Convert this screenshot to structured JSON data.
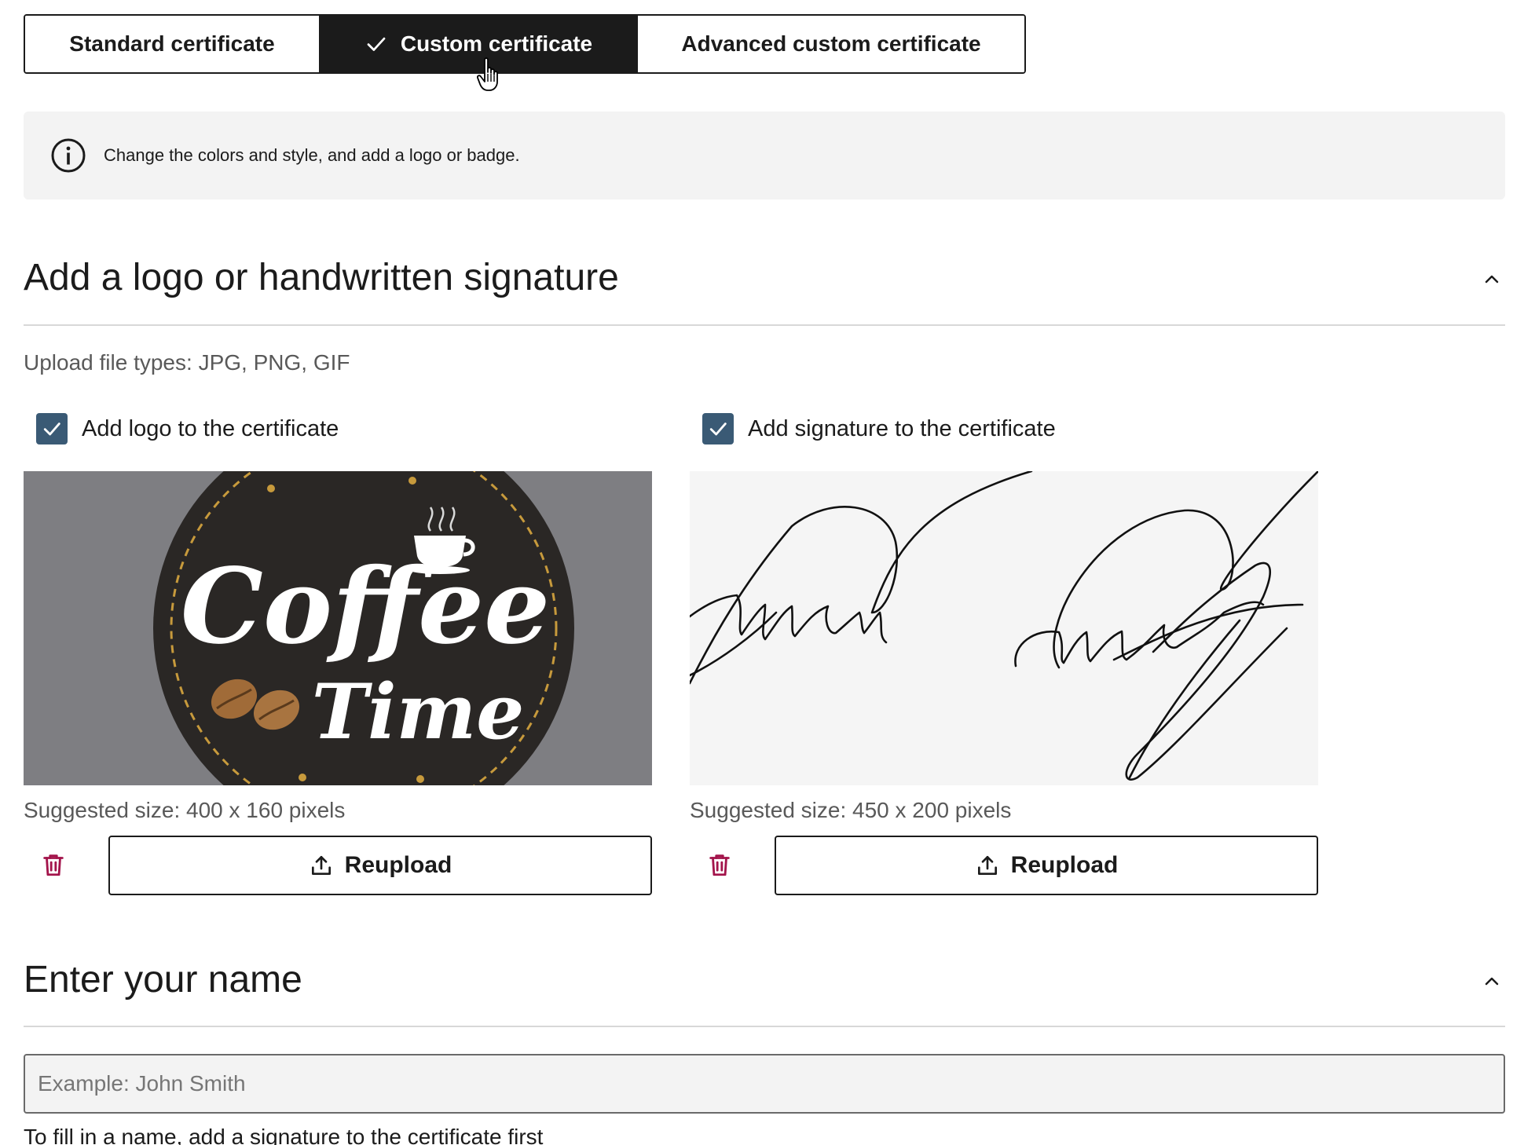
{
  "tabs": [
    {
      "label": "Standard certificate",
      "selected": false
    },
    {
      "label": "Custom certificate",
      "selected": true
    },
    {
      "label": "Advanced custom certificate",
      "selected": false
    }
  ],
  "info": {
    "icon": "info-circle-icon",
    "text": "Change the colors and style, and add a logo or badge."
  },
  "logo_section": {
    "title": "Add a logo or handwritten signature",
    "expanded": true,
    "file_types_hint": "Upload file types: JPG, PNG, GIF",
    "logo": {
      "checkbox_label": "Add logo to the certificate",
      "checked": true,
      "image": {
        "line1": "Coffee",
        "line2": "Time"
      },
      "size_note": "Suggested size: 400 x 160 pixels",
      "reupload_label": "Reupload"
    },
    "signature": {
      "checkbox_label": "Add signature to the certificate",
      "checked": true,
      "size_note": "Suggested size: 450 x 200 pixels",
      "reupload_label": "Reupload"
    }
  },
  "name_section": {
    "title": "Enter your name",
    "expanded": true,
    "input_value": "",
    "input_placeholder": "Example: John Smith",
    "helper_text": "To fill in a name, add a signature to the certificate first"
  },
  "colors": {
    "checkbox": "#3a5a75",
    "trash": "#a3144b",
    "selected_tab_bg": "#1b1b1b",
    "info_bg": "#f3f3f3"
  }
}
